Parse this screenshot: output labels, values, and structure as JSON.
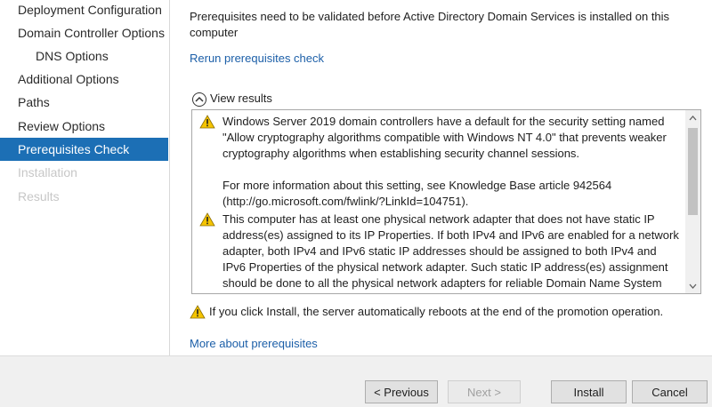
{
  "sidebar": {
    "items": [
      {
        "label": "Deployment Configuration"
      },
      {
        "label": "Domain Controller Options"
      },
      {
        "label": "DNS Options"
      },
      {
        "label": "Additional Options"
      },
      {
        "label": "Paths"
      },
      {
        "label": "Review Options"
      },
      {
        "label": "Prerequisites Check"
      },
      {
        "label": "Installation"
      },
      {
        "label": "Results"
      }
    ]
  },
  "main": {
    "intro_text": "Prerequisites need to be validated before Active Directory Domain Services is installed on this computer",
    "rerun_link": "Rerun prerequisites check",
    "view_results_label": "View results",
    "results": [
      {
        "icon": "warning-icon",
        "paragraphs": [
          "Windows Server 2019 domain controllers have a default for the security setting named \"Allow cryptography algorithms compatible with Windows NT 4.0\" that prevents weaker cryptography algorithms when establishing security channel sessions.",
          "For more information about this setting, see Knowledge Base article 942564 (http://go.microsoft.com/fwlink/?LinkId=104751)."
        ]
      },
      {
        "icon": "warning-icon",
        "paragraphs": [
          "This computer has at least one physical network adapter that does not have static IP address(es) assigned to its IP Properties. If both IPv4 and IPv6 are enabled for a network adapter, both IPv4 and IPv6 static IP addresses should be assigned to both IPv4 and IPv6 Properties of the physical network adapter. Such static IP address(es) assignment should be done to all the physical network adapters for reliable Domain Name System (DNS) operation."
        ]
      }
    ],
    "reboot_warning": "If you click Install, the server automatically reboots at the end of the promotion operation.",
    "more_link": "More about prerequisites"
  },
  "buttons": {
    "previous": "< Previous",
    "next": "Next >",
    "install": "Install",
    "cancel": "Cancel"
  },
  "colors": {
    "active_nav": "#1c6fb5",
    "link": "#1c5fa8",
    "warning": "#f5c400"
  }
}
